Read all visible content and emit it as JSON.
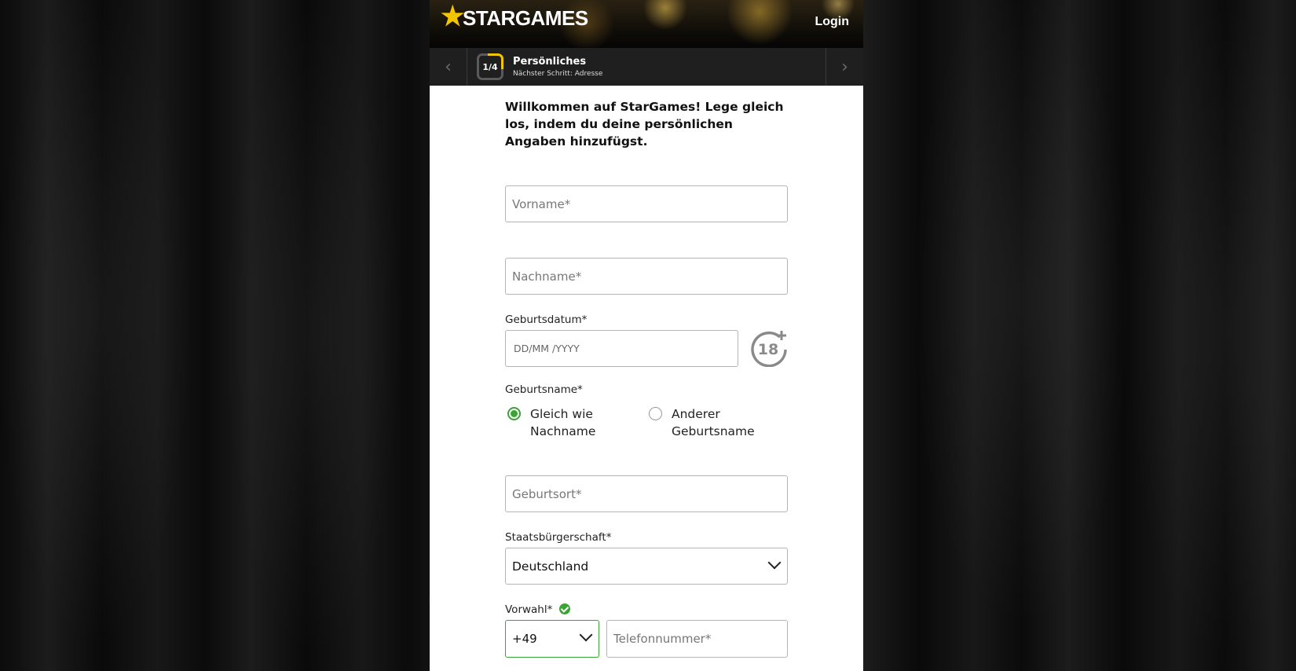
{
  "header": {
    "brand": "STARGAMES",
    "login_label": "Login"
  },
  "stepper": {
    "badge": "1/4",
    "title": "Persönliches",
    "subtitle": "Nächster Schritt: Adresse",
    "progress_fraction": 0.25
  },
  "form": {
    "intro": "Willkommen auf StarGames! Lege gleich los, indem du deine persönlichen Angaben hinzufügst.",
    "firstname_placeholder": "Vorname*",
    "lastname_placeholder": "Nachname*",
    "birthdate_label": "Geburtsdatum*",
    "birthdate_placeholder": "DD/MM /YYYY",
    "birthname_label": "Geburtsname*",
    "birthname_options": [
      {
        "label": "Gleich wie Nachname",
        "selected": true
      },
      {
        "label": "Anderer Geburtsname",
        "selected": false
      }
    ],
    "birthplace_placeholder": "Geburtsort*",
    "citizenship_label": "Staatsbürgerschaft*",
    "citizenship_value": "Deutschland",
    "prefix_label": "Vorwahl*",
    "prefix_value": "+49",
    "phone_placeholder": "Telefonnummer*"
  },
  "colors": {
    "accent": "#f5c400",
    "success": "#3aa535",
    "panel_bg": "#ffffff",
    "stepbar_bg": "#1f1f1f"
  },
  "icons": [
    "star-icon",
    "chevron-left-icon",
    "chevron-right-icon",
    "age-18-plus-icon",
    "chevron-down-icon",
    "check-circle-icon"
  ]
}
